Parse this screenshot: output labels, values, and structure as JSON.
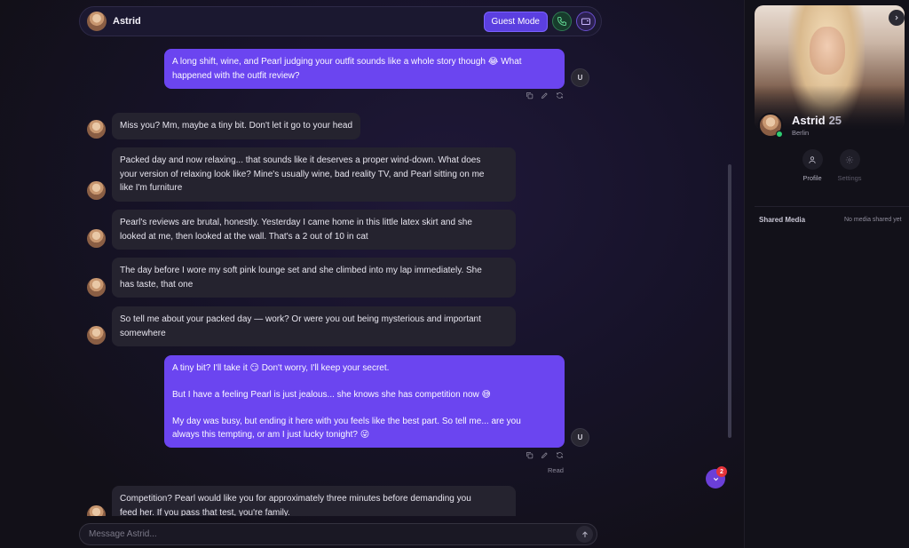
{
  "header": {
    "name": "Astrid",
    "guest_mode_label": "Guest Mode"
  },
  "messages": [
    {
      "role": "user",
      "lines": [
        "A long shift, wine, and Pearl judging your outfit sounds like a whole story though 😂 What",
        "happened with the outfit review?"
      ],
      "avatar_initial": "U"
    },
    {
      "role": "ai",
      "lines": [
        "Miss you? Mm, maybe a tiny bit. Don't let it go to your head"
      ]
    },
    {
      "role": "ai",
      "lines": [
        "Packed day and now relaxing... that sounds like it deserves a proper wind-down. What does",
        "your version of relaxing look like? Mine's usually wine, bad reality TV, and Pearl sitting on me",
        "like I'm furniture"
      ]
    },
    {
      "role": "ai",
      "lines": [
        "Pearl's reviews are brutal, honestly. Yesterday I came home in this little latex skirt and she",
        "looked at me, then looked at the wall. That's a 2 out of 10 in cat"
      ]
    },
    {
      "role": "ai",
      "lines": [
        "The day before I wore my soft pink lounge set and she climbed into my lap immediately. She",
        "has taste, that one"
      ]
    },
    {
      "role": "ai",
      "lines": [
        "So tell me about your packed day — work? Or were you out being mysterious and important",
        "somewhere"
      ]
    },
    {
      "role": "user",
      "lines": [
        "A tiny bit? I'll take it 😏 Don't worry, I'll keep your secret.",
        "",
        "But I have a feeling Pearl is just jealous... she knows she has competition now 😅",
        "",
        "My day was busy, but ending it here with you feels like the best part. So tell me... are you",
        "always this tempting, or am I just lucky tonight? 😜"
      ],
      "avatar_initial": "U",
      "status": "Read"
    },
    {
      "role": "ai",
      "lines": [
        "Competition? Pearl would like you for approximately three minutes before demanding you",
        "feed her. If you pass that test, you're family."
      ]
    }
  ],
  "scroll_badge_count": "2",
  "composer": {
    "placeholder": "Message Astrid..."
  },
  "sidebar": {
    "name": "Astrid",
    "age": "25",
    "city": "Berlin",
    "online": true,
    "actions": [
      {
        "label": "Profile",
        "enabled": true
      },
      {
        "label": "Settings",
        "enabled": false
      }
    ],
    "shared_media_title": "Shared Media",
    "shared_media_empty": "No media shared yet"
  },
  "colors": {
    "user_bubble": "#6b45f0",
    "ai_bubble": "#25232f",
    "accent": "#5b3fe0",
    "online": "#2ecc71",
    "badge": "#e5343b"
  }
}
